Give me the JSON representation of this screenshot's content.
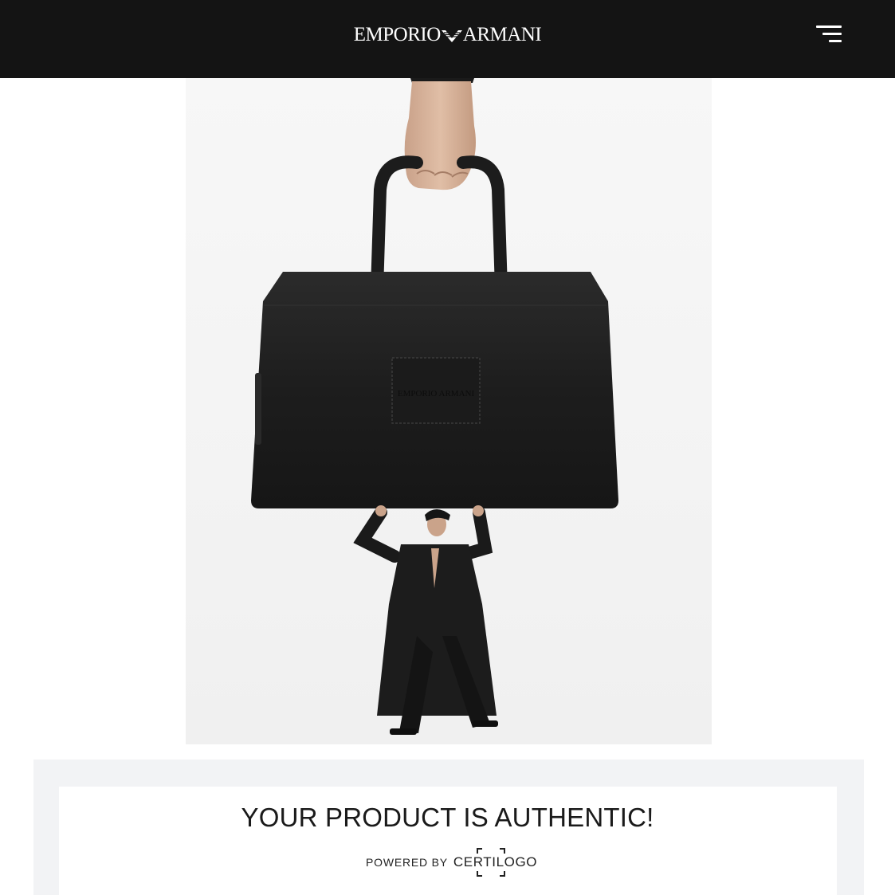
{
  "header": {
    "brand_left": "EMPORIO",
    "brand_right": "ARMANI",
    "menu_icon": "hamburger-menu-icon",
    "background": "#141414"
  },
  "hero": {
    "bag_logo_left": "EMPORIO",
    "bag_logo_right": "ARMANI",
    "image": "campaign photo: hand holding black leather briefcase above man in long black coat"
  },
  "verification": {
    "headline": "YOUR PRODUCT IS AUTHENTIC!",
    "powered_by": "POWERED BY",
    "provider": "CERTILOGO"
  }
}
